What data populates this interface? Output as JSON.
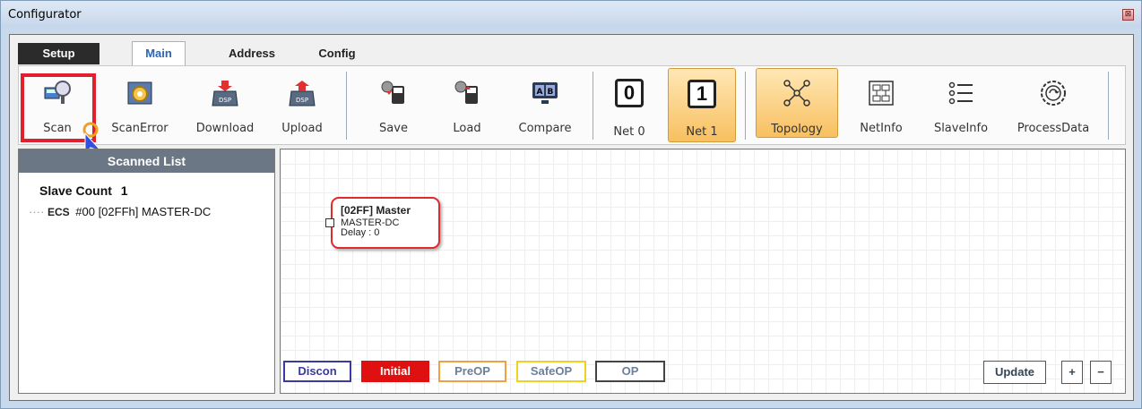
{
  "window": {
    "title": "Configurator",
    "close_glyph": "⊠"
  },
  "tabs": [
    {
      "label": "Setup"
    },
    {
      "label": "Main",
      "active": true
    },
    {
      "label": "Address"
    },
    {
      "label": "Config"
    }
  ],
  "toolbar": {
    "scan": "Scan",
    "scan_error": "ScanError",
    "download": "Download",
    "upload": "Upload",
    "save": "Save",
    "load": "Load",
    "compare": "Compare",
    "net0": "Net 0",
    "net0_num": "0",
    "net1": "Net 1",
    "net1_num": "1",
    "topology": "Topology",
    "netinfo": "NetInfo",
    "slaveinfo": "SlaveInfo",
    "processdata": "ProcessData",
    "selected": [
      "Net 1",
      "Topology"
    ]
  },
  "scanned_list": {
    "header": "Scanned List",
    "slave_count_label": "Slave Count",
    "slave_count": "1",
    "ecs_label": "ECS",
    "items": [
      {
        "text": "#00  [02FFh] MASTER-DC"
      }
    ]
  },
  "topology": {
    "node": {
      "title": "[02FF] Master",
      "name": "MASTER-DC",
      "delay": "Delay : 0"
    }
  },
  "states": [
    {
      "label": "Discon",
      "color": "#3a3aa0"
    },
    {
      "label": "Initial",
      "color": "#e01010"
    },
    {
      "label": "PreOP",
      "color": "#f0a040"
    },
    {
      "label": "SafeOP",
      "color": "#f0d020"
    },
    {
      "label": "OP",
      "color": "#444444"
    }
  ],
  "bottom_buttons": {
    "update": "Update",
    "plus": "+",
    "minus": "−"
  }
}
